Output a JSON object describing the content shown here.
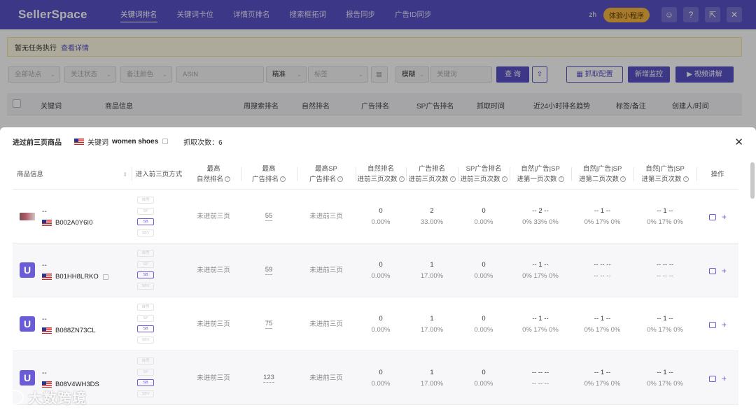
{
  "app": {
    "brand": "SellerSpace"
  },
  "nav": {
    "items": [
      "关键词排名",
      "关键词卡位",
      "详情页排名",
      "搜索框拓词",
      "报告同步",
      "广告ID同步"
    ],
    "active_index": 0
  },
  "topbar": {
    "lang": "zh",
    "mini_program": "体验小程序"
  },
  "notice": {
    "text": "暂无任务执行",
    "link": "查看详情"
  },
  "filters": {
    "site": "全部站点",
    "status": "关注状态",
    "color": "备注颜色",
    "asin": "ASIN",
    "match": "精准",
    "tag": "标签",
    "mode": "模糊",
    "keyword": "关键词",
    "query": "查 询",
    "capture_config": "抓取配置",
    "new_monitor": "新增监控",
    "video": "视频讲解"
  },
  "bg_table": {
    "headers": [
      "关键词",
      "商品信息",
      "周搜索排名",
      "自然排名",
      "广告排名",
      "SP广告排名",
      "抓取时间",
      "近24小时排名趋势",
      "标签/备注",
      "创建人/时间"
    ]
  },
  "modal": {
    "title": "进过前三页商品",
    "keyword_label": "关键词",
    "keyword": "women shoes",
    "count_label": "抓取次数",
    "count": "6",
    "headers": {
      "product": "商品信息",
      "way": "进入前三页方式",
      "h1a": "最高",
      "h1b": "自然排名",
      "h2a": "最高",
      "h2b": "广告排名",
      "h3a": "最高SP",
      "h3b": "广告排名",
      "h4a": "自然排名",
      "h4b": "进前三页次数",
      "h5a": "广告排名",
      "h5b": "进前三页次数",
      "h6a": "SP广告排名",
      "h6b": "进前三页次数",
      "h7a": "自然|广告|SP",
      "h7b": "进第一页次数",
      "h8a": "自然|广告|SP",
      "h8b": "进第二页次数",
      "h9a": "自然|广告|SP",
      "h9b": "进第三页次数",
      "ops": "操作"
    },
    "way_tags": [
      "自然",
      "SP",
      "SB",
      "SBV"
    ],
    "rows": [
      {
        "name": "--",
        "asin": "B002A0Y6I0",
        "thumb": "img",
        "ext": false,
        "way_active": [
          2
        ],
        "best_natural": "未进前三页",
        "best_ad": "55",
        "best_sp": "未进前三页",
        "nat_n": "0",
        "nat_p": "0.00%",
        "ad_n": "2",
        "ad_p": "33.00%",
        "sp_n": "0",
        "sp_p": "0.00%",
        "p1_a": "-- 2 --",
        "p1_b": "0% 33% 0%",
        "p2_a": "-- 1 --",
        "p2_b": "0% 17% 0%",
        "p3_a": "-- 1 --",
        "p3_b": "0% 17% 0%"
      },
      {
        "name": "--",
        "asin": "B01HH8LRKO",
        "thumb": "logo",
        "ext": true,
        "way_active": [
          2
        ],
        "best_natural": "未进前三页",
        "best_ad": "59",
        "best_sp": "未进前三页",
        "nat_n": "0",
        "nat_p": "0.00%",
        "ad_n": "1",
        "ad_p": "17.00%",
        "sp_n": "0",
        "sp_p": "0.00%",
        "p1_a": "-- 1 --",
        "p1_b": "0% 17% 0%",
        "p2_a": "-- -- --",
        "p2_b": "-- -- --",
        "p3_a": "-- -- --",
        "p3_b": "-- -- --"
      },
      {
        "name": "--",
        "asin": "B088ZN73CL",
        "thumb": "logo",
        "ext": false,
        "way_active": [
          2
        ],
        "best_natural": "未进前三页",
        "best_ad": "75",
        "best_sp": "未进前三页",
        "nat_n": "0",
        "nat_p": "0.00%",
        "ad_n": "1",
        "ad_p": "17.00%",
        "sp_n": "0",
        "sp_p": "0.00%",
        "p1_a": "-- 1 --",
        "p1_b": "0% 17% 0%",
        "p2_a": "-- 1 --",
        "p2_b": "0% 17% 0%",
        "p3_a": "-- 1 --",
        "p3_b": "0% 17% 0%"
      },
      {
        "name": "--",
        "asin": "B08V4WH3DS",
        "thumb": "logo",
        "ext": false,
        "way_active": [
          2
        ],
        "best_natural": "未进前三页",
        "best_ad": "123",
        "best_sp": "未进前三页",
        "nat_n": "0",
        "nat_p": "0.00%",
        "ad_n": "1",
        "ad_p": "17.00%",
        "sp_n": "0",
        "sp_p": "0.00%",
        "p1_a": "-- -- --",
        "p1_b": "-- -- --",
        "p2_a": "-- 1 --",
        "p2_b": "0% 17% 0%",
        "p3_a": "-- 1 --",
        "p3_b": "0% 17% 0%"
      }
    ]
  },
  "watermark": "大数跨境",
  "colors": {
    "primary": "#5b52c8",
    "accent": "#6a5cd6",
    "warning_bg": "#fffbe6",
    "badge": "#f5b642"
  }
}
